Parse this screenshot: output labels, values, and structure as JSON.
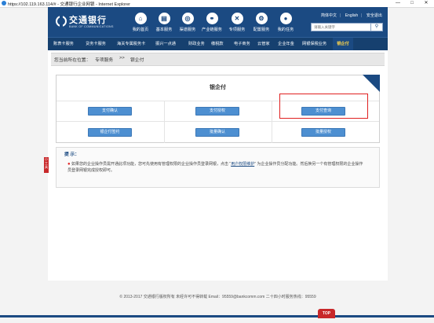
{
  "window": {
    "title": "https://102.119.163.114/# - 交通银行企业网银 - Internet Explorer",
    "controls": [
      "—",
      "□",
      "✕"
    ]
  },
  "header": {
    "logo_cn": "交通银行",
    "logo_en": "BANK OF COMMUNICATIONS",
    "nav_icons": [
      {
        "label": "我的首页",
        "icon": "home-icon",
        "glyph": "⌂"
      },
      {
        "label": "基本服务",
        "icon": "document-icon",
        "glyph": "▤"
      },
      {
        "label": "渠道服务",
        "icon": "swirl-icon",
        "glyph": "◎"
      },
      {
        "label": "产业链服务",
        "icon": "link-icon",
        "glyph": "⚭"
      },
      {
        "label": "专项服务",
        "icon": "tools-icon",
        "glyph": "✕"
      },
      {
        "label": "配置服务",
        "icon": "gear-icon",
        "glyph": "⚙"
      },
      {
        "label": "我的任务",
        "icon": "person-icon",
        "glyph": "●"
      }
    ],
    "top_links": [
      "简体中文",
      "English",
      "安全退出"
    ],
    "search": {
      "placeholder": "请输入关键字",
      "button": "⚲"
    }
  },
  "menu": {
    "items": [
      "账表卡服务",
      "贷务卡服务",
      "海关专属税务卡",
      "振兴一点通",
      "财政业务",
      "缴税款",
      "电子商务",
      "云管家",
      "企业年金",
      "网银保税业务",
      "银企付"
    ],
    "active": "银企付"
  },
  "breadcrumb": {
    "prefix": "您当前所在位置：",
    "path": "专项服务",
    "sep": ">>",
    "current": "银企付"
  },
  "panel": {
    "title": "银企付",
    "buttons_row1": [
      "支付确认",
      "支付授权",
      "支付查询"
    ],
    "buttons_row2": [
      "银企付签约",
      "批量确认",
      "批量授权"
    ]
  },
  "tips": {
    "heading": "提 示：",
    "text_before": "如果您的企业操作员需开通此项功能，您可先使用有管理权限的企业操作员登录网银，点击 \"",
    "link": "用户权限维护",
    "text_after": "\" 为企业操作员分配功能。然后换另一个有管理权限的企业操作员登录网银完成授权即可。"
  },
  "side_tab": "小工具",
  "footer": {
    "text": "© 2013-2017 交通银行版权所有 未经许可不得转载 Email：95559@bankcomm.com 二十四小时服务热线：95559",
    "top_button": "TOP"
  },
  "colors": {
    "brand_blue": "#1b4a82",
    "button_blue": "#4d8fd1",
    "highlight_red": "#e02020"
  }
}
